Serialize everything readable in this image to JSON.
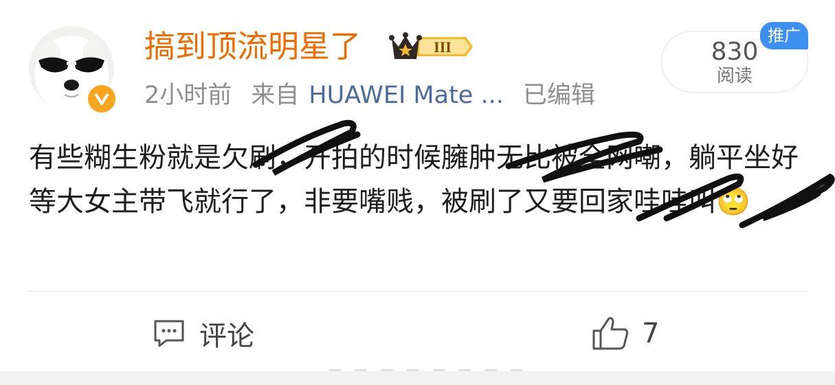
{
  "header": {
    "username": "搞到顶流明星了",
    "level_badge": "III",
    "time": "2小时前",
    "source_prefix": "来自",
    "device": "HUAWEI Mate ...",
    "edited": "已编辑",
    "read_count": "830",
    "read_label": "阅读",
    "promo_label": "推广"
  },
  "post": {
    "text": "有些糊生粉就是欠刷，开拍的时候臃肿无比被全网嘲，躺平坐好等大女主带飞就行了，非要嘴贱，被刷了又要回家哇哇叫🙄"
  },
  "actions": {
    "comment_label": "评论",
    "like_count": "7"
  },
  "colors": {
    "username": "#f06c00",
    "device_link": "#4b6c9b",
    "promo_badge": "#3d8ff0",
    "verify_badge": "#f7a51c"
  }
}
